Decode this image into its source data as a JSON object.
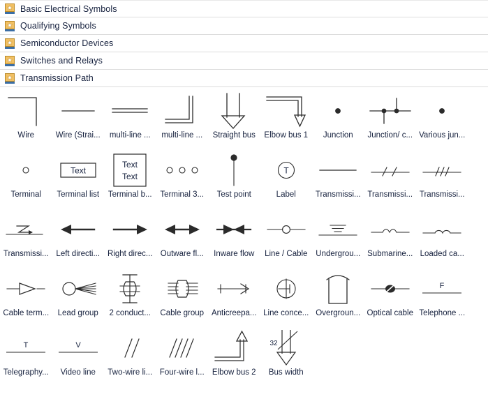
{
  "categories": [
    {
      "label": "Basic Electrical Symbols",
      "icon": "library-icon"
    },
    {
      "label": "Qualifying Symbols",
      "icon": "library-icon"
    },
    {
      "label": "Semiconductor Devices",
      "icon": "library-icon"
    },
    {
      "label": "Switches and Relays",
      "icon": "library-icon"
    },
    {
      "label": "Transmission Path",
      "icon": "library-icon"
    }
  ],
  "colors": {
    "icon_fill": "#f2c063",
    "icon_border": "#b98a28",
    "icon_base": "#3b6ea5",
    "row_separator": "#dcdcdc",
    "text": "#16213e",
    "stroke": "#2b2b2b"
  },
  "symbols": [
    {
      "label": "Wire",
      "art": "wire-corner"
    },
    {
      "label": "Wire (Strai...",
      "art": "wire-straight"
    },
    {
      "label": "multi-line ...",
      "art": "multiline-straight"
    },
    {
      "label": "multi-line ...",
      "art": "multiline-corner"
    },
    {
      "label": "Straight bus",
      "art": "straight-bus-arrow"
    },
    {
      "label": "Elbow bus 1",
      "art": "elbow-bus-1"
    },
    {
      "label": "Junction",
      "art": "junction-dot"
    },
    {
      "label": "Junction/ c...",
      "art": "junction-crossing"
    },
    {
      "label": "Various jun...",
      "art": "various-junction-dot"
    },
    {
      "label": "Terminal",
      "art": "terminal-circle"
    },
    {
      "label": "Terminal list",
      "art": "terminal-list-box",
      "text": "Text"
    },
    {
      "label": "Terminal b...",
      "art": "terminal-block-box",
      "text_lines": [
        "Text",
        "Text"
      ]
    },
    {
      "label": "Terminal 3...",
      "art": "terminal-three-circles"
    },
    {
      "label": "Test point",
      "art": "test-point"
    },
    {
      "label": "Label",
      "art": "label-circle-t",
      "text": "T"
    },
    {
      "label": "Transmissi...",
      "art": "transmission-plain-line"
    },
    {
      "label": "Transmissi...",
      "art": "transmission-two-ticks"
    },
    {
      "label": "Transmissi...",
      "art": "transmission-three-ticks"
    },
    {
      "label": "Transmissi...",
      "art": "transmission-zigzag-arrow"
    },
    {
      "label": "Left directi...",
      "art": "arrow-left"
    },
    {
      "label": "Right direc...",
      "art": "arrow-right"
    },
    {
      "label": "Outware fl...",
      "art": "arrow-double-outward"
    },
    {
      "label": "Inware flow",
      "art": "arrow-double-inward"
    },
    {
      "label": "Line / Cable",
      "art": "line-cable-circle"
    },
    {
      "label": "Undergrou...",
      "art": "underground-cable"
    },
    {
      "label": "Submarine...",
      "art": "submarine-cable"
    },
    {
      "label": "Loaded ca...",
      "art": "loaded-cable"
    },
    {
      "label": "Cable term...",
      "art": "cable-termination"
    },
    {
      "label": "Lead group",
      "art": "lead-group"
    },
    {
      "label": "2 conduct...",
      "art": "two-conductor-cable"
    },
    {
      "label": "Cable group",
      "art": "cable-group"
    },
    {
      "label": "Anticreepa...",
      "art": "anticreepage-device"
    },
    {
      "label": "Line conce...",
      "art": "line-concentrator"
    },
    {
      "label": "Overgroun...",
      "art": "overground-enclosure"
    },
    {
      "label": "Optical cable",
      "art": "optical-cable"
    },
    {
      "label": "Telephone ...",
      "art": "telephone-line",
      "text": "F"
    },
    {
      "label": "Telegraphy...",
      "art": "telegraphy-line",
      "text": "T"
    },
    {
      "label": "Video line",
      "art": "video-line",
      "text": "V"
    },
    {
      "label": "Two-wire li...",
      "art": "two-wire-line"
    },
    {
      "label": "Four-wire l...",
      "art": "four-wire-line"
    },
    {
      "label": "Elbow bus 2",
      "art": "elbow-bus-2"
    },
    {
      "label": "Bus width",
      "art": "bus-width",
      "text": "32"
    }
  ]
}
